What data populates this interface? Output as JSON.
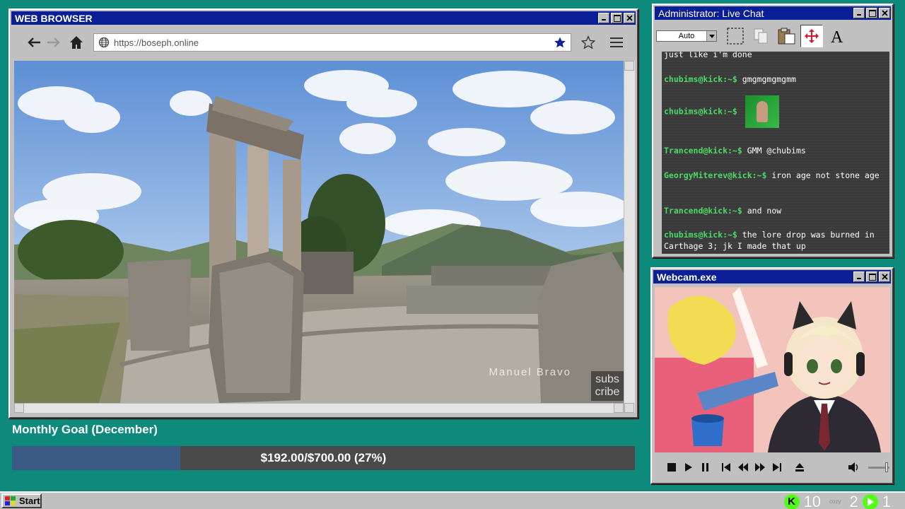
{
  "browser": {
    "title": "WEB BROWSER",
    "url": "https://boseph.online",
    "video": {
      "watermark": "Manuel Bravo",
      "subscribe_text": "subs cribe"
    }
  },
  "goal": {
    "title": "Monthly Goal (December)",
    "text": "$192.00/$700.00 (27%)",
    "fraction": 0.27,
    "fill_color": "#3b5a85",
    "track_color": "#4a4a4a"
  },
  "chat": {
    "title": "Administrator: Live Chat",
    "font_select": "Auto",
    "messages": [
      {
        "user": "",
        "text": "just like i'm done"
      },
      {
        "user": "chubims@kick:~$",
        "text": "gmgmgmgmgmm"
      },
      {
        "user": "chubims@kick:~$",
        "text": "",
        "emote": "green-screen-emote"
      },
      {
        "user": "Trancend@kick:~$",
        "text": "GMM @chubims"
      },
      {
        "user": "GeorgyMiterev@kick:~$",
        "text": "iron age not stone age"
      },
      {
        "user": "Trancend@kick:~$",
        "text": "and now"
      },
      {
        "user": "chubims@kick:~$",
        "text": "the lore drop was burned in Carthage 3; jk I made that up"
      }
    ],
    "user_color": "#4cd964"
  },
  "webcam": {
    "title": "Webcam.exe"
  },
  "taskbar": {
    "start_label": "Start",
    "kick_count": "10",
    "cozy_label": "cozy",
    "cozy_count": "2",
    "play_count": "1",
    "accent": "#53fc18"
  },
  "colors": {
    "desktop": "#0d8a7c",
    "titlebar": "#0a1e96"
  }
}
